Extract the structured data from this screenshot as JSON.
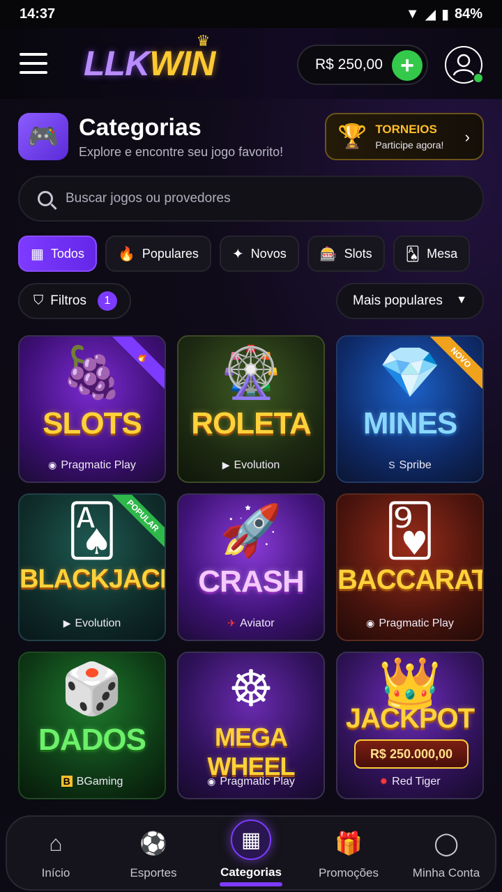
{
  "status": {
    "time": "14:37",
    "battery": "84%"
  },
  "header": {
    "logo_a": "LLK",
    "logo_b": "WIN",
    "balance": "R$ 250,00"
  },
  "page": {
    "title": "Categorias",
    "subtitle": "Explore e encontre seu jogo favorito!"
  },
  "torneios": {
    "title": "TORNEIOS",
    "subtitle": "Participe agora!"
  },
  "search": {
    "placeholder": "Buscar jogos ou provedores"
  },
  "tabs": [
    {
      "label": "Todos",
      "icon": "grid-icon"
    },
    {
      "label": "Populares",
      "icon": "fire-icon"
    },
    {
      "label": "Novos",
      "icon": "sparkle-icon"
    },
    {
      "label": "Slots",
      "icon": "slot-machine-icon"
    },
    {
      "label": "Mesa",
      "icon": "table-cards-icon"
    }
  ],
  "filters": {
    "label": "Filtros",
    "count": "1",
    "sort": "Mais populares"
  },
  "games": [
    {
      "name": "SLOTS",
      "provider": "Pragmatic Play",
      "badge": ""
    },
    {
      "name": "ROLETA",
      "provider": "Evolution",
      "badge": ""
    },
    {
      "name": "MINES",
      "provider": "Spribe",
      "badge": "NOVO"
    },
    {
      "name": "BLACKJACK",
      "provider": "Evolution",
      "badge": "POPULAR"
    },
    {
      "name": "CRASH",
      "provider": "Aviator",
      "badge": ""
    },
    {
      "name": "BACCARAT",
      "provider": "Pragmatic Play",
      "badge": ""
    },
    {
      "name": "DADOS",
      "provider": "BGaming",
      "badge": ""
    },
    {
      "name": "MEGA WHEEL",
      "provider": "Pragmatic Play",
      "badge": ""
    },
    {
      "name": "JACKPOT",
      "provider": "Red Tiger",
      "badge": "",
      "amount": "R$ 250.000,00"
    }
  ],
  "nav": [
    {
      "label": "Início",
      "icon": "home-icon"
    },
    {
      "label": "Esportes",
      "icon": "soccer-ball-icon"
    },
    {
      "label": "Categorias",
      "icon": "grid-icon"
    },
    {
      "label": "Promoções",
      "icon": "gift-icon"
    },
    {
      "label": "Minha Conta",
      "icon": "user-icon"
    }
  ],
  "colors": {
    "accent": "#7d3bff",
    "success": "#34c94a",
    "gold": "#ffbf2a"
  }
}
